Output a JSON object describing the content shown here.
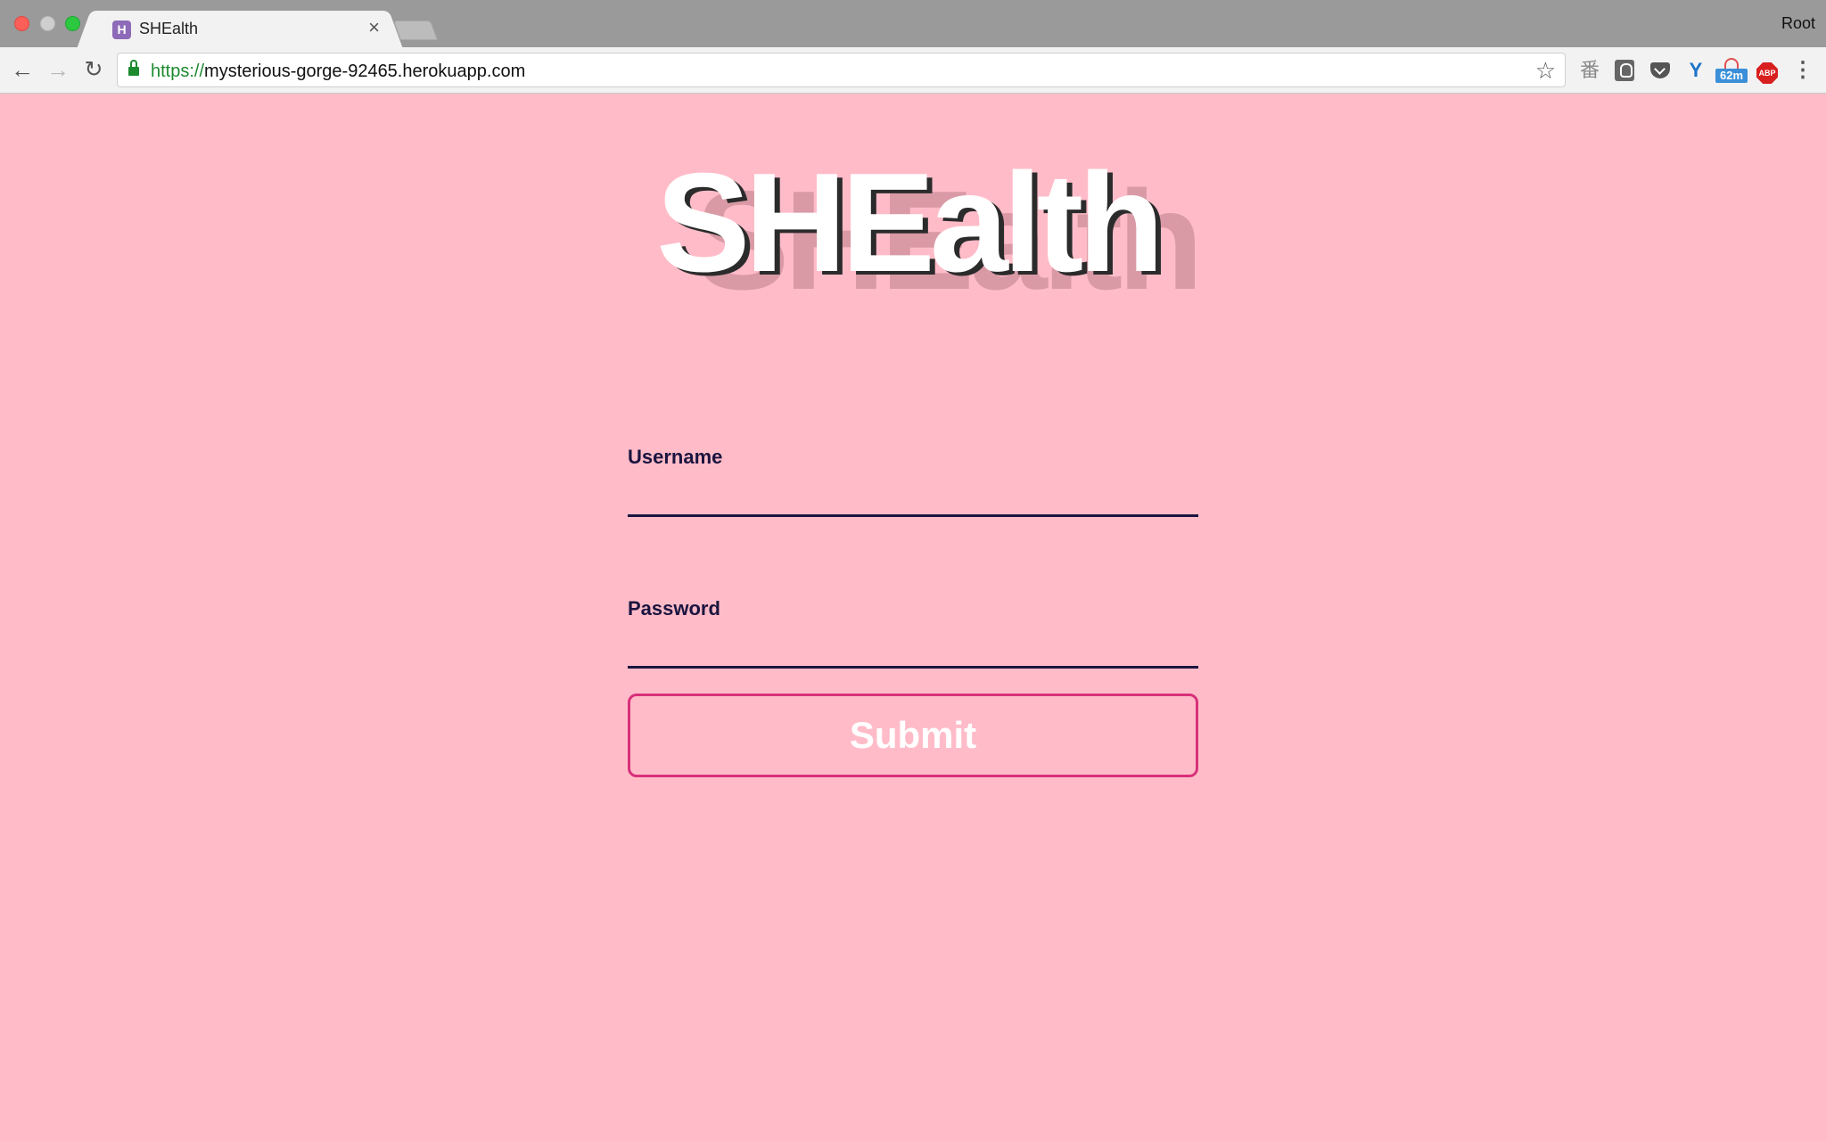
{
  "browser": {
    "tab_title": "SHEalth",
    "tab_favicon_letter": "H",
    "tab_close": "×",
    "profile_name": "Root",
    "url_scheme": "https://",
    "url_host": "mysterious-gorge-92465.herokuapp.com",
    "extensions": {
      "ext1": "番",
      "ext4": "Y",
      "ext5_badge": "62m",
      "ext6_label": "ABP"
    },
    "colors": {
      "titlebar": "#9a9a9a",
      "toolbar": "#f2f2f2",
      "secure_green": "#1c8a2f"
    }
  },
  "page": {
    "logo_text": "SHEalth",
    "form": {
      "username_label": "Username",
      "username_value": "",
      "password_label": "Password",
      "password_value": "",
      "submit_label": "Submit"
    },
    "colors": {
      "background": "#ffbcc8",
      "label": "#1b1440",
      "button_border": "#d8307a",
      "button_text": "#ffffff"
    }
  }
}
